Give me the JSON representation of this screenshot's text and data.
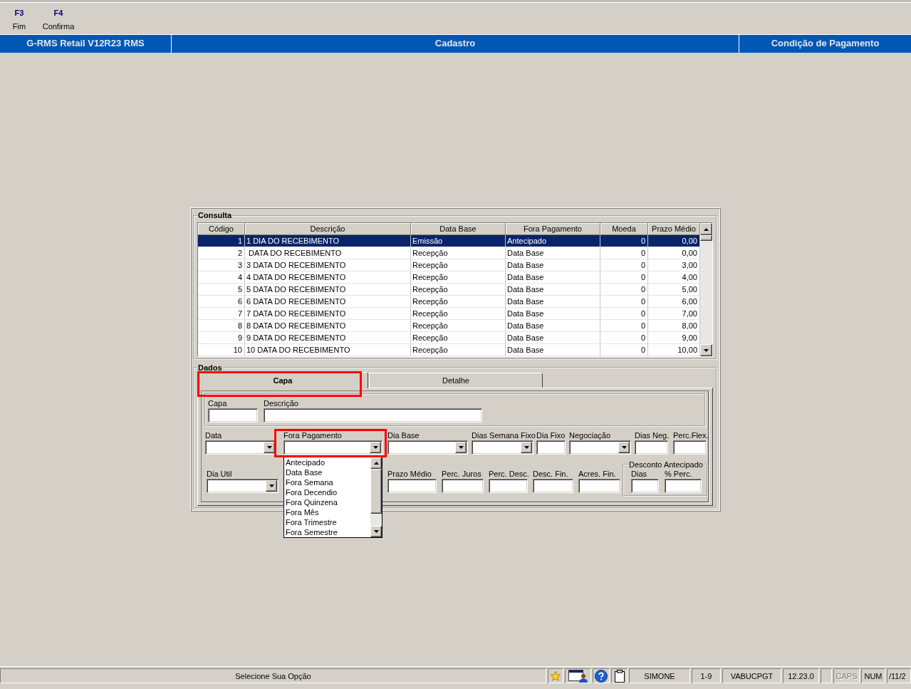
{
  "toolbar": {
    "buttons": [
      {
        "key": "F3",
        "label": "Fim"
      },
      {
        "key": "F4",
        "label": "Confirma"
      }
    ]
  },
  "title_bar": {
    "sections": [
      "G-RMS Retail V12R23 RMS",
      "Cadastro",
      "Condição de Pagamento"
    ]
  },
  "consulta": {
    "title": "Consulta",
    "columns": [
      "Código",
      "Descrição",
      "Data Base",
      "Fora Pagamento",
      "Moeda",
      "Prazo Médio"
    ],
    "rows": [
      {
        "selected": true,
        "cells": [
          "1",
          "1 DIA DO RECEBIMENTO",
          "Emissão",
          "Antecipado",
          "0",
          "0,00"
        ]
      },
      {
        "selected": false,
        "cells": [
          "2",
          " DATA DO RECEBIMENTO",
          "Recepção",
          "Data Base",
          "0",
          "0,00"
        ]
      },
      {
        "selected": false,
        "cells": [
          "3",
          "3 DATA DO RECEBIMENTO",
          "Recepção",
          "Data Base",
          "0",
          "3,00"
        ]
      },
      {
        "selected": false,
        "cells": [
          "4",
          "4 DATA DO RECEBIMENTO",
          "Recepção",
          "Data Base",
          "0",
          "4,00"
        ]
      },
      {
        "selected": false,
        "cells": [
          "5",
          "5 DATA DO RECEBIMENTO",
          "Recepção",
          "Data Base",
          "0",
          "5,00"
        ]
      },
      {
        "selected": false,
        "cells": [
          "6",
          "6 DATA DO RECEBIMENTO",
          "Recepção",
          "Data Base",
          "0",
          "6,00"
        ]
      },
      {
        "selected": false,
        "cells": [
          "7",
          "7 DATA DO RECEBIMENTO",
          "Recepção",
          "Data Base",
          "0",
          "7,00"
        ]
      },
      {
        "selected": false,
        "cells": [
          "8",
          "8 DATA DO RECEBIMENTO",
          "Recepção",
          "Data Base",
          "0",
          "8,00"
        ]
      },
      {
        "selected": false,
        "cells": [
          "9",
          "9 DATA DO RECEBIMENTO",
          "Recepção",
          "Data Base",
          "0",
          "9,00"
        ]
      },
      {
        "selected": false,
        "cells": [
          "10",
          "10 DATA DO RECEBIMENTO",
          "Recepção",
          "Data Base",
          "0",
          "10,00"
        ]
      }
    ]
  },
  "dados": {
    "title": "Dados",
    "tabs": [
      {
        "label": "Capa",
        "selected": true,
        "highlighted": true
      },
      {
        "label": "Detalhe",
        "selected": false,
        "highlighted": false
      }
    ],
    "capa_group": [
      {
        "label": "Capa",
        "kind": "text"
      },
      {
        "label": "Descrição",
        "kind": "text"
      }
    ],
    "row_1": [
      {
        "label": "Data",
        "kind": "combo",
        "highlighted": false,
        "open": false
      },
      {
        "label": "Fora Pagamento",
        "kind": "combo",
        "highlighted": true,
        "open": true,
        "options": [
          "Antecipado",
          "Data Base",
          "Fora Semana",
          "Fora Decendio",
          "Fora Quinzena",
          "Fora Mês",
          "Fora Trimestre",
          "Fora Semestre"
        ]
      },
      {
        "label": "Dia Base",
        "kind": "combo",
        "highlighted": false,
        "open": false
      },
      {
        "label": "Dias Semana Fixo",
        "kind": "combo",
        "highlighted": false,
        "open": false
      },
      {
        "label": "Dia Fixo",
        "kind": "text",
        "highlighted": false
      },
      {
        "label": "Negociação",
        "kind": "combo",
        "highlighted": false,
        "open": false
      },
      {
        "label": "Dias Neg.",
        "kind": "text",
        "highlighted": false
      },
      {
        "label": "Perc.Flex.",
        "kind": "text",
        "highlighted": false
      }
    ],
    "row_2": [
      {
        "label": "Dia Util",
        "kind": "combo",
        "open": false
      },
      {
        "label": "Prazo Médio",
        "kind": "text"
      },
      {
        "label": "Perc. Juros",
        "kind": "text"
      },
      {
        "label": "Perc. Desc.",
        "kind": "text"
      },
      {
        "label": "Desc. Fin.",
        "kind": "text"
      },
      {
        "label": "Acres. Fin.",
        "kind": "text"
      }
    ],
    "desconto_antecipado": {
      "title": "Desconto Antecipado",
      "fields": [
        {
          "label": "Dias",
          "kind": "text"
        },
        {
          "label": "% Perc.",
          "kind": "text"
        }
      ]
    }
  },
  "status_bar": {
    "message": "Selecione Sua Opção",
    "panels": [
      {
        "text": "SIMONE",
        "disabled": false
      },
      {
        "text": "1-9",
        "disabled": false
      },
      {
        "text": "VABUCPGT",
        "disabled": false
      },
      {
        "text": "12.23.0",
        "disabled": false
      },
      {
        "text": "CAPS",
        "disabled": true
      },
      {
        "text": "NUM",
        "disabled": false
      },
      {
        "text": "/11/2",
        "disabled": false
      }
    ]
  }
}
